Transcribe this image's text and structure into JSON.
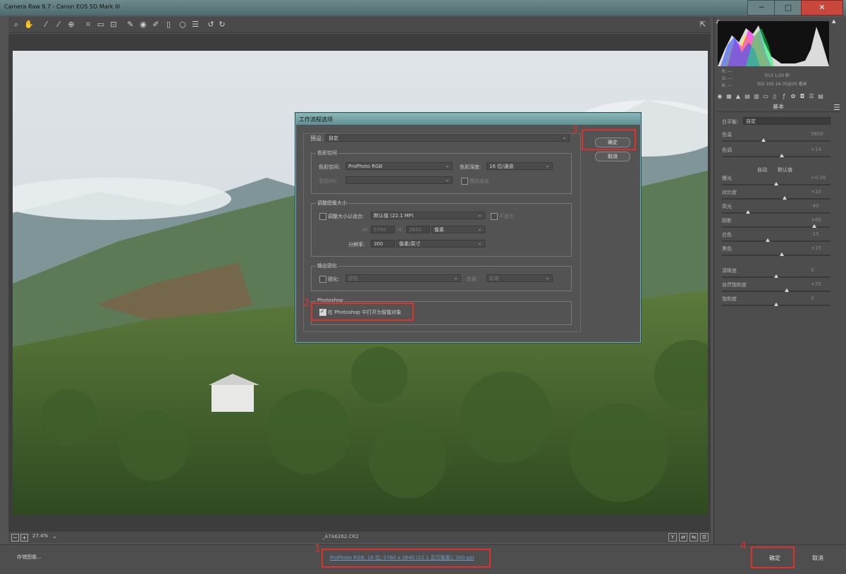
{
  "window": {
    "title": "Camera Raw 9.7 -  Canon EOS 5D Mark III",
    "close_glyph": "✕",
    "min_glyph": "─",
    "max_glyph": "□"
  },
  "toolbar": {
    "tools": [
      "zoom-icon",
      "hand-icon",
      "white-balance-icon",
      "color-sampler-icon",
      "target-adjust-icon",
      "crop-icon",
      "straighten-icon",
      "transform-icon",
      "spot-removal-icon",
      "red-eye-icon",
      "adjustment-brush-icon",
      "graduated-filter-icon",
      "radial-filter-icon",
      "rotate-left-icon",
      "rotate-right-icon"
    ],
    "open_prefs_icon": "preferences-icon"
  },
  "status": {
    "zoom_minus": "−",
    "zoom_plus": "+",
    "zoom_value": "27.4%",
    "filename": "_A7A6262.CR2"
  },
  "bottom": {
    "save_image": "存储图像...",
    "workflow_link": "ProPhoto RGB; 16 位; 5760 x 3840 (22.1 百万像素); 300 ppi",
    "ok": "确定",
    "cancel": "取消"
  },
  "panel": {
    "info_r": "R:  ---",
    "info_g": "G:  ---",
    "info_b": "B:  ---",
    "info_exif1": "f/13   1/20 秒",
    "info_exif2": "ISO 100   16-35@35 毫米",
    "title": "基本",
    "wb_label": "白平衡:",
    "wb_value": "自定",
    "auto": "自动",
    "default": "默认值",
    "sliders": [
      {
        "label": "色温",
        "value": "5800"
      },
      {
        "label": "色调",
        "value": "+14"
      },
      {
        "label": "曝光",
        "value": "+0.30"
      },
      {
        "label": "对比度",
        "value": "+10"
      },
      {
        "label": "高光",
        "value": "-40"
      },
      {
        "label": "阴影",
        "value": "+60"
      },
      {
        "label": "白色",
        "value": "-15"
      },
      {
        "label": "黑色",
        "value": "+15"
      },
      {
        "label": "清晰度",
        "value": "0"
      },
      {
        "label": "自然饱和度",
        "value": "+25"
      },
      {
        "label": "饱和度",
        "value": "0"
      }
    ]
  },
  "dialog": {
    "title": "工作流程选项",
    "preset_label": "预设:",
    "preset_value": "自定",
    "ok": "确定",
    "cancel": "取消",
    "color_space": {
      "legend": "色彩空间",
      "space_label": "色彩空间:",
      "space_value": "ProPhoto RGB",
      "depth_label": "色彩深度:",
      "depth_value": "16 位/通道",
      "intent_label": "意图(N):",
      "intent_value": "",
      "simulate_label": "模拟纸张"
    },
    "resize": {
      "legend": "调整图像大小",
      "fit_label": "调整大小以适合:",
      "fit_value": "默认值 (22.1 MP)",
      "no_enlarge": "不放大",
      "w_label": "W:",
      "w_value": "5760",
      "h_label": "H:",
      "h_value": "3840",
      "unit_value": "像素",
      "res_label": "分辨率:",
      "res_value": "300",
      "res_unit": "像素/英寸"
    },
    "sharpen": {
      "legend": "输出锐化",
      "sharpen_label": "锐化:",
      "sharpen_value": "滤色",
      "amount_label": "数量:",
      "amount_value": "标准"
    },
    "photoshop": {
      "legend": "Photoshop",
      "smart_object_label": "在 Photoshop 中打开为智能对象"
    }
  },
  "annotations": {
    "n1": "1",
    "n2": "2",
    "n3": "3",
    "n4": "4"
  }
}
